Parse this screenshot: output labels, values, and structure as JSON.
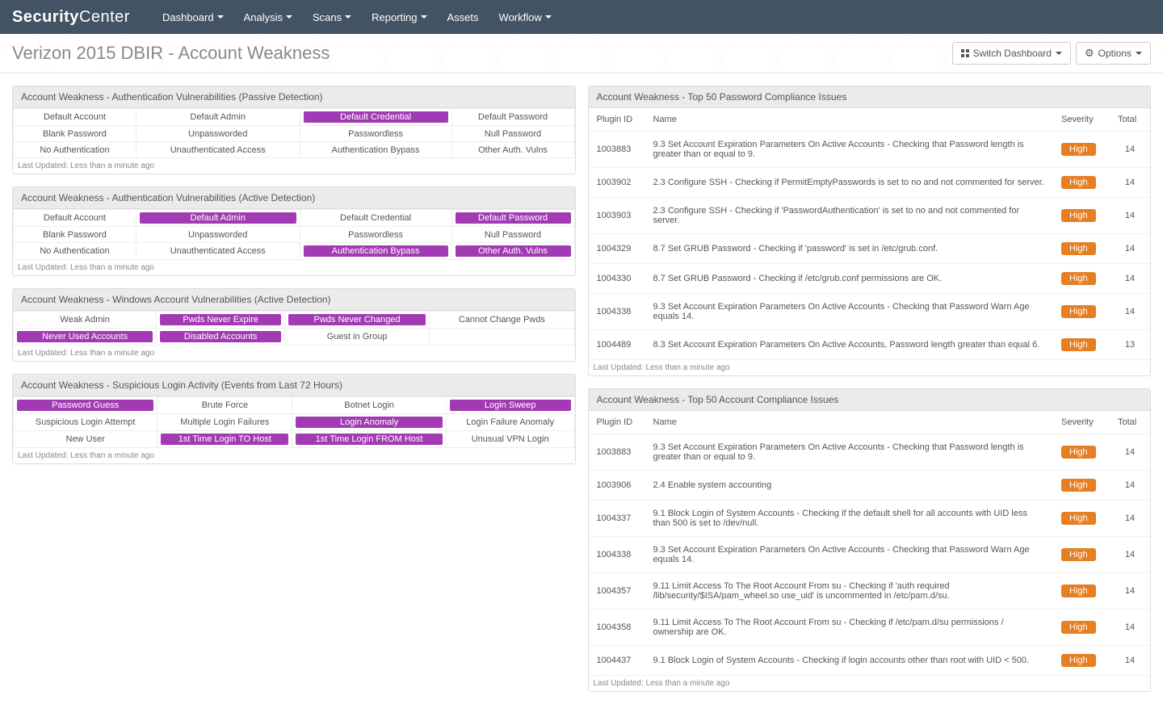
{
  "brand": {
    "left": "Security",
    "right": "Center"
  },
  "nav": [
    "Dashboard",
    "Analysis",
    "Scans",
    "Reporting",
    "Assets",
    "Workflow"
  ],
  "nav_has_caret": [
    true,
    true,
    true,
    true,
    false,
    true
  ],
  "page_title": "Verizon 2015 DBIR - Account Weakness",
  "buttons": {
    "switch": "Switch Dashboard",
    "options": "Options"
  },
  "last_updated": "Last Updated: Less than a minute ago",
  "panels_left": [
    {
      "title": "Account Weakness - Authentication Vulnerabilities (Passive Detection)",
      "rows": [
        [
          {
            "t": "Default Account"
          },
          {
            "t": "Default Admin"
          },
          {
            "t": "Default Credential",
            "hl": true
          },
          {
            "t": "Default Password"
          }
        ],
        [
          {
            "t": "Blank Password"
          },
          {
            "t": "Unpassworded"
          },
          {
            "t": "Passwordless"
          },
          {
            "t": "Null Password"
          }
        ],
        [
          {
            "t": "No Authentication"
          },
          {
            "t": "Unauthenticated Access"
          },
          {
            "t": "Authentication Bypass"
          },
          {
            "t": "Other Auth. Vulns"
          }
        ]
      ]
    },
    {
      "title": "Account Weakness - Authentication Vulnerabilities (Active Detection)",
      "rows": [
        [
          {
            "t": "Default Account"
          },
          {
            "t": "Default Admin",
            "hl": true
          },
          {
            "t": "Default Credential"
          },
          {
            "t": "Default Password",
            "hl": true
          }
        ],
        [
          {
            "t": "Blank Password"
          },
          {
            "t": "Unpassworded"
          },
          {
            "t": "Passwordless"
          },
          {
            "t": "Null Password"
          }
        ],
        [
          {
            "t": "No Authentication"
          },
          {
            "t": "Unauthenticated Access"
          },
          {
            "t": "Authentication Bypass",
            "hl": true
          },
          {
            "t": "Other Auth. Vulns",
            "hl": true
          }
        ]
      ]
    },
    {
      "title": "Account Weakness - Windows Account Vulnerabilities (Active Detection)",
      "rows": [
        [
          {
            "t": "Weak Admin"
          },
          {
            "t": "Pwds Never Expire",
            "hl": true
          },
          {
            "t": "Pwds Never Changed",
            "hl": true
          },
          {
            "t": "Cannot Change Pwds"
          }
        ],
        [
          {
            "t": "Never Used Accounts",
            "hl": true
          },
          {
            "t": "Disabled Accounts",
            "hl": true
          },
          {
            "t": "Guest in Group"
          },
          {
            "t": ""
          }
        ]
      ]
    },
    {
      "title": "Account Weakness - Suspicious Login Activity (Events from Last 72 Hours)",
      "rows": [
        [
          {
            "t": "Password Guess",
            "hl": true
          },
          {
            "t": "Brute Force"
          },
          {
            "t": "Botnet Login"
          },
          {
            "t": "Login Sweep",
            "hl": true
          }
        ],
        [
          {
            "t": "Suspicious Login Attempt"
          },
          {
            "t": "Multiple Login Failures"
          },
          {
            "t": "Login Anomaly",
            "hl": true
          },
          {
            "t": "Login Failure Anomaly"
          }
        ],
        [
          {
            "t": "New User"
          },
          {
            "t": "1st Time Login TO Host",
            "hl": true
          },
          {
            "t": "1st Time Login FROM Host",
            "hl": true
          },
          {
            "t": "Unusual VPN Login"
          }
        ]
      ]
    }
  ],
  "table_headers": {
    "plugin": "Plugin ID",
    "name": "Name",
    "severity": "Severity",
    "total": "Total"
  },
  "panels_right": [
    {
      "title": "Account Weakness - Top 50 Password Compliance Issues",
      "rows": [
        {
          "id": "1003883",
          "name": "9.3 Set Account Expiration Parameters On Active Accounts - Checking that Password length is greater than or equal to 9.",
          "sev": "High",
          "total": "14"
        },
        {
          "id": "1003902",
          "name": "2.3 Configure SSH - Checking if PermitEmptyPasswords is set to no and not commented for server.",
          "sev": "High",
          "total": "14"
        },
        {
          "id": "1003903",
          "name": "2.3 Configure SSH - Checking if 'PasswordAuthentication' is set to no and not commented for server.",
          "sev": "High",
          "total": "14"
        },
        {
          "id": "1004329",
          "name": "8.7 Set GRUB Password - Checking if 'password' is set in /etc/grub.conf.",
          "sev": "High",
          "total": "14"
        },
        {
          "id": "1004330",
          "name": "8.7 Set GRUB Password - Checking if /etc/grub.conf permissions are OK.",
          "sev": "High",
          "total": "14"
        },
        {
          "id": "1004338",
          "name": "9.3 Set Account Expiration Parameters On Active Accounts - Checking that Password Warn Age equals 14.",
          "sev": "High",
          "total": "14"
        },
        {
          "id": "1004489",
          "name": "8.3 Set Account Expiration Parameters On Active Accounts, Password length greater than equal 6.",
          "sev": "High",
          "total": "13"
        }
      ]
    },
    {
      "title": "Account Weakness - Top 50 Account Compliance Issues",
      "rows": [
        {
          "id": "1003883",
          "name": "9.3 Set Account Expiration Parameters On Active Accounts - Checking that Password length is greater than or equal to 9.",
          "sev": "High",
          "total": "14"
        },
        {
          "id": "1003906",
          "name": "2.4 Enable system accounting",
          "sev": "High",
          "total": "14"
        },
        {
          "id": "1004337",
          "name": "9.1 Block Login of System Accounts - Checking if the default shell for all accounts with UID less than 500 is set to /dev/null.",
          "sev": "High",
          "total": "14"
        },
        {
          "id": "1004338",
          "name": "9.3 Set Account Expiration Parameters On Active Accounts - Checking that Password Warn Age equals 14.",
          "sev": "High",
          "total": "14"
        },
        {
          "id": "1004357",
          "name": "9.11 Limit Access To The Root Account From su - Checking if 'auth required /lib/security/$ISA/pam_wheel.so use_uid' is uncommented in /etc/pam.d/su.",
          "sev": "High",
          "total": "14"
        },
        {
          "id": "1004358",
          "name": "9.11 Limit Access To The Root Account From su - Checking if /etc/pam.d/su permissions / ownership are OK.",
          "sev": "High",
          "total": "14"
        },
        {
          "id": "1004437",
          "name": "9.1 Block Login of System Accounts - Checking if login accounts other than root with UID < 500.",
          "sev": "High",
          "total": "14"
        }
      ]
    }
  ]
}
